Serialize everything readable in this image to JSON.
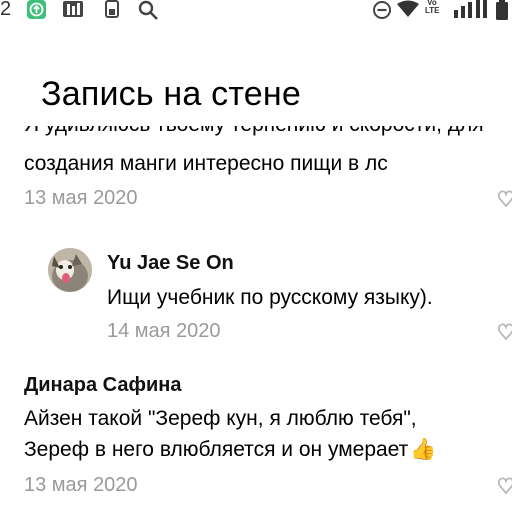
{
  "status_bar": {
    "time_fragment": "2",
    "icons": [
      "app-badge-icon",
      "notification-icon",
      "notification-icon",
      "search-icon",
      "do-not-disturb-icon",
      "wifi-icon",
      "volte-icon",
      "signal-icon",
      "battery-icon"
    ],
    "volte_text": "Vo\nLTE"
  },
  "page": {
    "title": "Запись на стене"
  },
  "comments": [
    {
      "clipped_line": "Я удивляюсь твоему терпению и скорости, для",
      "text": "создания манги интересно пищи в лс",
      "date": "13 мая 2020"
    },
    {
      "author": "Yu Jae Se On",
      "text": "Ищи учебник по русскому языку).",
      "date": "14 мая 2020",
      "reply": true
    },
    {
      "author": "Динара Сафина",
      "lines": [
        "Айзен такой \"Зереф кун, я люблю тебя\",",
        "Зереф в него влюбляется и он умерает"
      ],
      "emoji": "👍",
      "date": "13 мая 2020"
    }
  ],
  "colors": {
    "date": "#9a9a9a",
    "badge": "#3ec07a",
    "text": "#000000"
  }
}
